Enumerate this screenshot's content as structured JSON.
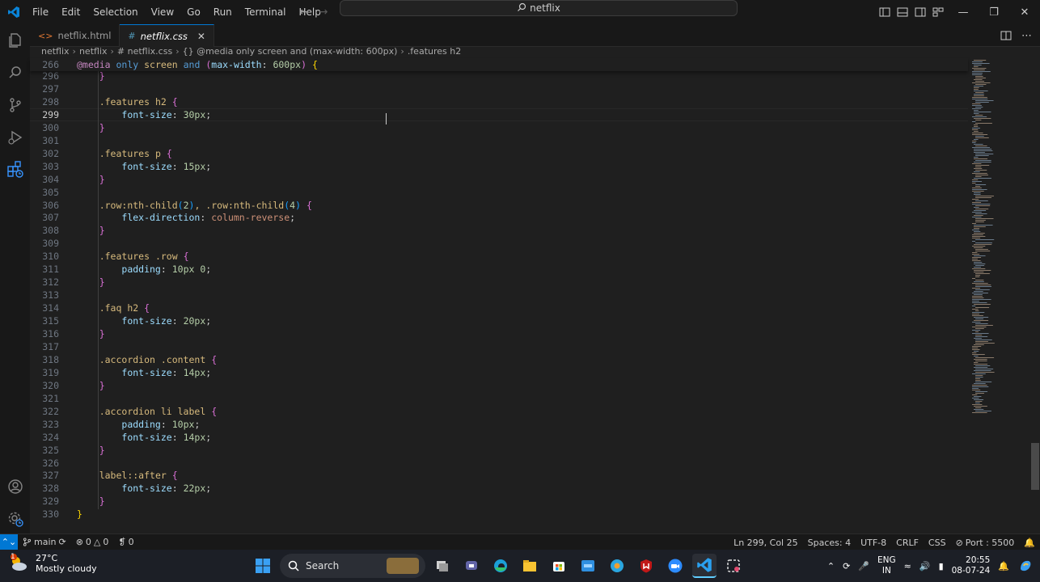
{
  "menu": [
    "File",
    "Edit",
    "Selection",
    "View",
    "Go",
    "Run",
    "Terminal",
    "Help"
  ],
  "command_center": "netflix",
  "tabs": [
    {
      "icon": "<>",
      "label": "netflix.html",
      "active": false
    },
    {
      "icon": "#",
      "label": "netflix.css",
      "active": true
    }
  ],
  "breadcrumb": {
    "parts": [
      "netflix",
      "netflix",
      "# netflix.css",
      "{} @media only screen and (max-width: 600px)",
      ".features h2"
    ]
  },
  "sticky_line": {
    "num": "266",
    "text": "@media only screen and (max-width: 600px) {"
  },
  "code_lines": [
    {
      "num": "296",
      "text": "    }"
    },
    {
      "num": "297",
      "text": ""
    },
    {
      "num": "298",
      "text": "    .features h2 {"
    },
    {
      "num": "299",
      "text": "        font-size: 30px;"
    },
    {
      "num": "300",
      "text": "    }"
    },
    {
      "num": "301",
      "text": ""
    },
    {
      "num": "302",
      "text": "    .features p {"
    },
    {
      "num": "303",
      "text": "        font-size: 15px;"
    },
    {
      "num": "304",
      "text": "    }"
    },
    {
      "num": "305",
      "text": ""
    },
    {
      "num": "306",
      "text": "    .row:nth-child(2), .row:nth-child(4) {"
    },
    {
      "num": "307",
      "text": "        flex-direction: column-reverse;"
    },
    {
      "num": "308",
      "text": "    }"
    },
    {
      "num": "309",
      "text": ""
    },
    {
      "num": "310",
      "text": "    .features .row {"
    },
    {
      "num": "311",
      "text": "        padding: 10px 0;"
    },
    {
      "num": "312",
      "text": "    }"
    },
    {
      "num": "313",
      "text": ""
    },
    {
      "num": "314",
      "text": "    .faq h2 {"
    },
    {
      "num": "315",
      "text": "        font-size: 20px;"
    },
    {
      "num": "316",
      "text": "    }"
    },
    {
      "num": "317",
      "text": ""
    },
    {
      "num": "318",
      "text": "    .accordion .content {"
    },
    {
      "num": "319",
      "text": "        font-size: 14px;"
    },
    {
      "num": "320",
      "text": "    }"
    },
    {
      "num": "321",
      "text": ""
    },
    {
      "num": "322",
      "text": "    .accordion li label {"
    },
    {
      "num": "323",
      "text": "        padding: 10px;"
    },
    {
      "num": "324",
      "text": "        font-size: 14px;"
    },
    {
      "num": "325",
      "text": "    }"
    },
    {
      "num": "326",
      "text": ""
    },
    {
      "num": "327",
      "text": "    label::after {"
    },
    {
      "num": "328",
      "text": "        font-size: 22px;"
    },
    {
      "num": "329",
      "text": "    }"
    },
    {
      "num": "330",
      "text": "}"
    }
  ],
  "current_line": "299",
  "statusbar": {
    "branch": "main",
    "errors": "0",
    "warnings": "0",
    "ports": "0",
    "position": "Ln 299, Col 25",
    "spaces": "Spaces: 4",
    "encoding": "UTF-8",
    "eol": "CRLF",
    "language": "CSS",
    "port": "Port : 5500"
  },
  "taskbar": {
    "weather_badge": "1",
    "temperature": "27°C",
    "condition": "Mostly cloudy",
    "search_label": "Search",
    "lang_top": "ENG",
    "lang_bottom": "IN",
    "time": "20:55",
    "date": "08-07-24"
  },
  "colors": {
    "accent": "#0078d4",
    "background": "#1f1f1f",
    "chrome": "#181818"
  }
}
